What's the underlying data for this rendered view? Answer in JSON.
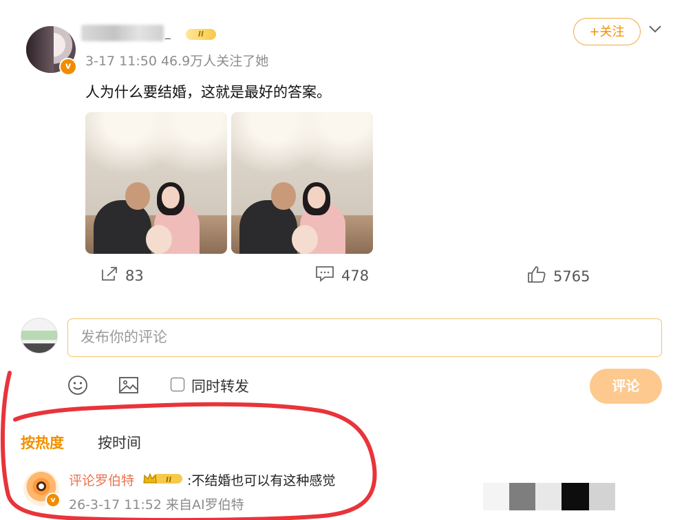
{
  "post": {
    "username_tail": "_",
    "level_badge": "II",
    "verified_mark": "v",
    "meta": "3-17 11:50  46.9万人关注了她",
    "follow_label": "+关注",
    "text": "人为什么要结婚，这就是最好的答案。"
  },
  "actions": {
    "share_count": "83",
    "comment_count": "478",
    "like_count": "5765"
  },
  "composer": {
    "placeholder": "发布你的评论",
    "repost_label": "同时转发",
    "submit_label": "评论"
  },
  "sort": {
    "hot_label": "按热度",
    "time_label": "按时间"
  },
  "comment": {
    "author": "评论罗伯特",
    "badge": "II",
    "verified_mark": "v",
    "text": ":不结婚也可以有这种感觉",
    "meta": "26-3-17 11:52 来自AI罗伯特"
  },
  "icons": {
    "share": "share-icon",
    "comment": "comment-icon",
    "like": "thumbs-up-icon",
    "emoji": "emoji-icon",
    "image": "image-icon",
    "chevron": "chevron-down-icon"
  },
  "colors": {
    "accent": "#f09000",
    "follow_border": "#f3a73c",
    "submit_bg": "#fdc98e",
    "input_border": "#f1c46b",
    "commenter_name": "#eb7350",
    "annotation_red": "#e8343a",
    "mosaic": [
      "#f4f4f4",
      "#7e7e7e",
      "#e8e8e8",
      "#0d0d0d",
      "#d3d3d3",
      "#ffffff"
    ]
  }
}
